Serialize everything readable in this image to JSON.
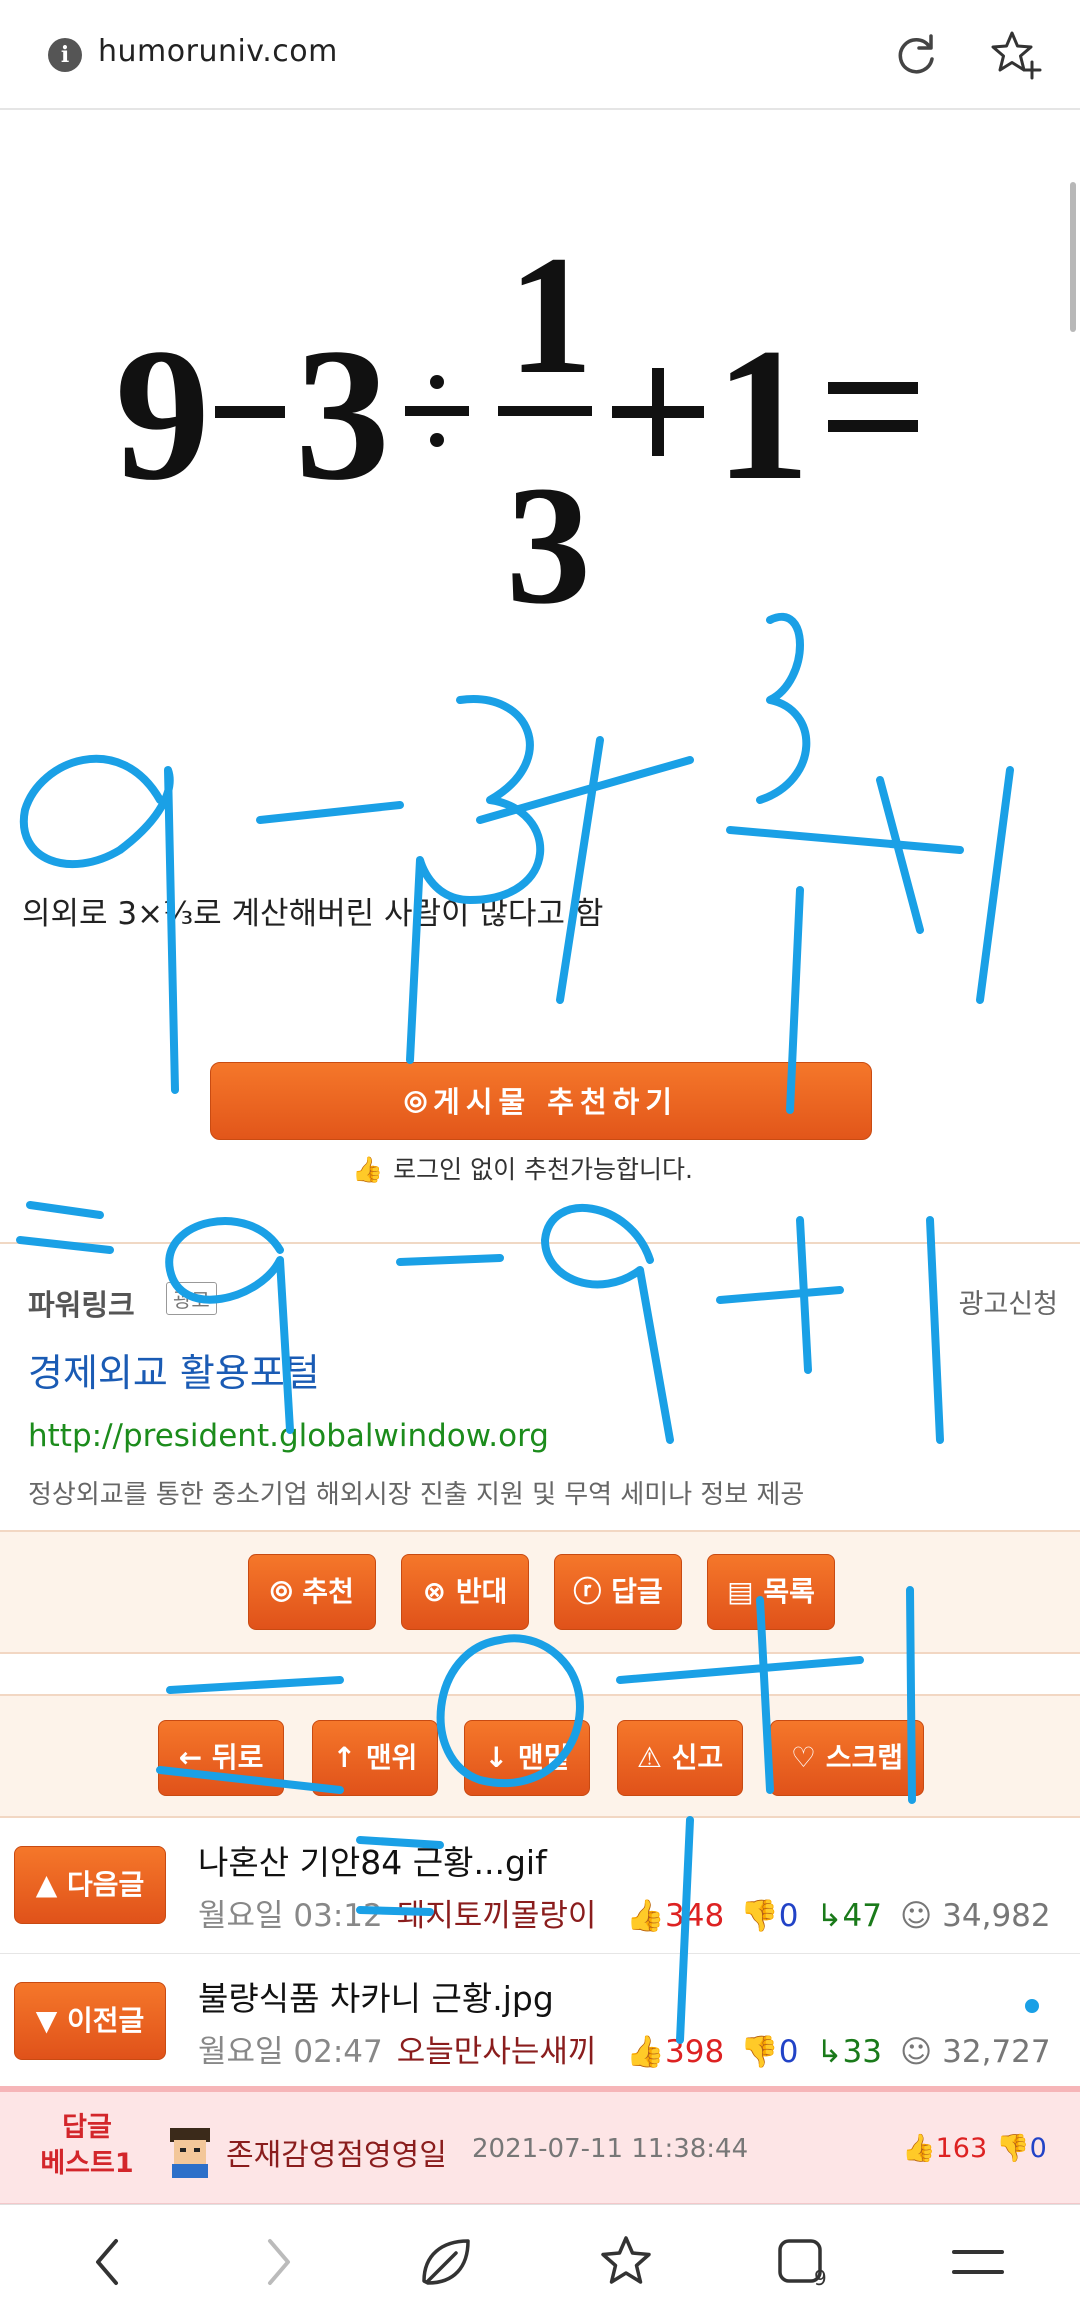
{
  "browser": {
    "url": "humoruniv.com"
  },
  "post": {
    "equation": {
      "a": "9",
      "b": "3",
      "c": "1",
      "d": "3",
      "e": "1"
    },
    "caption": "의외로 3×⅓로 계산해버린 사람이 많다고 함",
    "recommend_button": "⦾게시물 추천하기",
    "login_note": "로그인 없이 추천가능합니다."
  },
  "ad": {
    "label": "파워링크",
    "badge": "광고",
    "apply": "광고신청",
    "title": "경제외교 활용포털",
    "url": "http://president.globalwindow.org",
    "description": "정상외교를 통한 중소기업 해외시장 진출 지원 및 무역 세미나 정보 제공"
  },
  "actions": {
    "recommend": "⦾ 추천",
    "oppose": "⊗ 반대",
    "reply": "ⓡ 답글",
    "list": "▤ 목록"
  },
  "navigation": {
    "back": "← 뒤로",
    "top": "↑ 맨위",
    "bottom": "↓ 맨밑",
    "report": "⚠ 신고",
    "scrap": "♡ 스크랩"
  },
  "next_post": {
    "button": "▲ 다음글",
    "title": "나혼산 기안84 근황...gif",
    "time": "월요일 03:12",
    "author": "돼지토끼몰랑이",
    "up": "348",
    "down": "0",
    "replies": "47",
    "views": "34,982"
  },
  "prev_post": {
    "button": "▼ 이전글",
    "title": "불량식품 차카니 근황.jpg",
    "time": "월요일 02:47",
    "author": "오늘만사는새끼",
    "up": "398",
    "down": "0",
    "replies": "33",
    "views": "32,727"
  },
  "best_reply": {
    "label_line1": "답글",
    "label_line2": "베스트1",
    "user": "존재감영점영영일",
    "date": "2021-07-11 11:38:44",
    "up": "163",
    "down": "0"
  },
  "colors": {
    "accent": "#ec6420",
    "drawing": "#1aa0e6",
    "link": "#1a5bb4",
    "url": "#1c8c1c"
  }
}
